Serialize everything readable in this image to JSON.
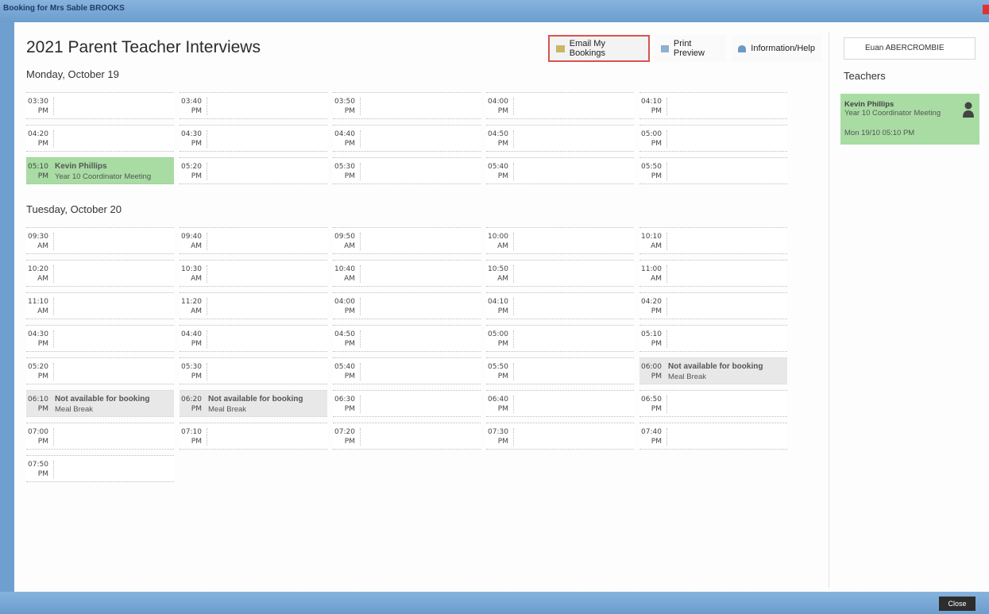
{
  "window": {
    "title": "Booking for Mrs Sable BROOKS",
    "app_title": "2021 Parent Teacher Interviews"
  },
  "toolbar": {
    "email_label": "Email My Bookings",
    "print_label": "Print Preview",
    "info_label": "Information/Help"
  },
  "student": {
    "name": "Euan ABERCROMBIE"
  },
  "days": [
    {
      "heading": "Monday, October 19",
      "slots": [
        {
          "time": "03:30",
          "ampm": "PM"
        },
        {
          "time": "03:40",
          "ampm": "PM"
        },
        {
          "time": "03:50",
          "ampm": "PM"
        },
        {
          "time": "04:00",
          "ampm": "PM"
        },
        {
          "time": "04:10",
          "ampm": "PM"
        },
        {
          "time": "04:20",
          "ampm": "PM"
        },
        {
          "time": "04:30",
          "ampm": "PM"
        },
        {
          "time": "04:40",
          "ampm": "PM"
        },
        {
          "time": "04:50",
          "ampm": "PM"
        },
        {
          "time": "05:00",
          "ampm": "PM"
        },
        {
          "time": "05:10",
          "ampm": "PM",
          "status": "booked",
          "name": "Kevin Phillips",
          "sub": "Year 10 Coordinator Meeting"
        },
        {
          "time": "05:20",
          "ampm": "PM"
        },
        {
          "time": "05:30",
          "ampm": "PM"
        },
        {
          "time": "05:40",
          "ampm": "PM"
        },
        {
          "time": "05:50",
          "ampm": "PM"
        }
      ]
    },
    {
      "heading": "Tuesday, October 20",
      "slots": [
        {
          "time": "09:30",
          "ampm": "AM"
        },
        {
          "time": "09:40",
          "ampm": "AM"
        },
        {
          "time": "09:50",
          "ampm": "AM"
        },
        {
          "time": "10:00",
          "ampm": "AM"
        },
        {
          "time": "10:10",
          "ampm": "AM"
        },
        {
          "time": "10:20",
          "ampm": "AM"
        },
        {
          "time": "10:30",
          "ampm": "AM"
        },
        {
          "time": "10:40",
          "ampm": "AM"
        },
        {
          "time": "10:50",
          "ampm": "AM"
        },
        {
          "time": "11:00",
          "ampm": "AM"
        },
        {
          "time": "11:10",
          "ampm": "AM"
        },
        {
          "time": "11:20",
          "ampm": "AM"
        },
        {
          "time": "04:00",
          "ampm": "PM"
        },
        {
          "time": "04:10",
          "ampm": "PM"
        },
        {
          "time": "04:20",
          "ampm": "PM"
        },
        {
          "time": "04:30",
          "ampm": "PM"
        },
        {
          "time": "04:40",
          "ampm": "PM"
        },
        {
          "time": "04:50",
          "ampm": "PM"
        },
        {
          "time": "05:00",
          "ampm": "PM"
        },
        {
          "time": "05:10",
          "ampm": "PM"
        },
        {
          "time": "05:20",
          "ampm": "PM"
        },
        {
          "time": "05:30",
          "ampm": "PM"
        },
        {
          "time": "05:40",
          "ampm": "PM"
        },
        {
          "time": "05:50",
          "ampm": "PM"
        },
        {
          "time": "06:00",
          "ampm": "PM",
          "status": "unavailable",
          "name": "Not available for booking",
          "sub": "Meal Break"
        },
        {
          "time": "06:10",
          "ampm": "PM",
          "status": "unavailable",
          "name": "Not available for booking",
          "sub": "Meal Break"
        },
        {
          "time": "06:20",
          "ampm": "PM",
          "status": "unavailable",
          "name": "Not available for booking",
          "sub": "Meal Break"
        },
        {
          "time": "06:30",
          "ampm": "PM"
        },
        {
          "time": "06:40",
          "ampm": "PM"
        },
        {
          "time": "06:50",
          "ampm": "PM"
        },
        {
          "time": "07:00",
          "ampm": "PM"
        },
        {
          "time": "07:10",
          "ampm": "PM"
        },
        {
          "time": "07:20",
          "ampm": "PM"
        },
        {
          "time": "07:30",
          "ampm": "PM"
        },
        {
          "time": "07:40",
          "ampm": "PM"
        },
        {
          "time": "07:50",
          "ampm": "PM"
        }
      ]
    }
  ],
  "teachers_panel": {
    "heading": "Teachers",
    "cards": [
      {
        "name": "Kevin Phillips",
        "role": "Year 10 Coordinator Meeting",
        "booking": "Mon 19/10 05:10 PM"
      }
    ]
  },
  "footer": {
    "close_label": "Close"
  },
  "colors": {
    "chrome_blue": "#6f9fcf",
    "booked_green": "#a8dca3",
    "unavailable_grey": "#e8e8e8",
    "highlight_red": "#d9534f"
  },
  "icons": {
    "email": "envelope-icon",
    "print": "printer-icon",
    "info": "info-icon",
    "teacher": "person-icon"
  }
}
